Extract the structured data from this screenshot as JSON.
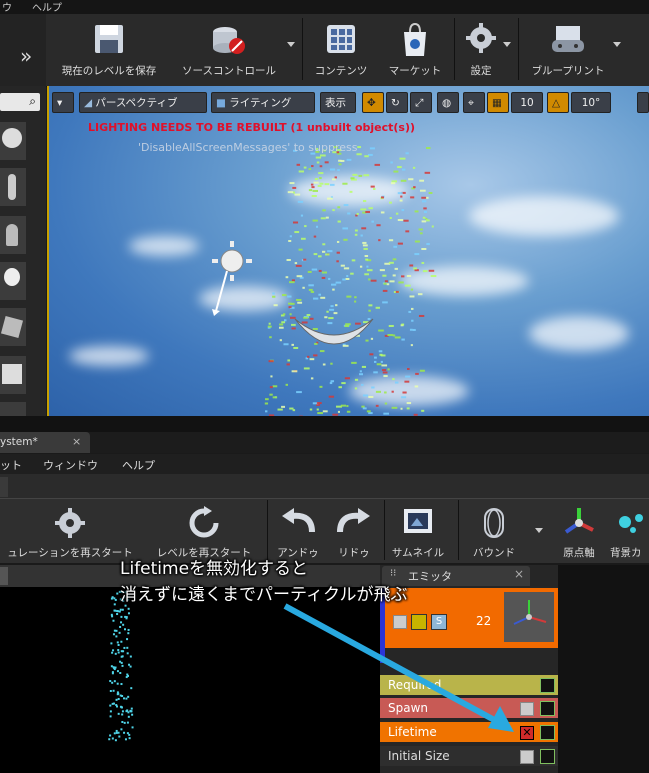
{
  "top_menu": {
    "item1": "ウ",
    "item2": "ヘルプ"
  },
  "main_toolbar": {
    "save": "現在のレベルを保存",
    "source_control": "ソースコントロール",
    "content": "コンテンツ",
    "marketplace": "マーケット",
    "settings": "設定",
    "blueprints": "ブループリント"
  },
  "viewport_toolbar": {
    "perspective": "パースペクティブ",
    "lighting": "ライティング",
    "show": "表示",
    "grid_snap_value": "10",
    "rotate_snap_value": "10°"
  },
  "viewport": {
    "warning": "LIGHTING NEEDS TO BE REBUILT (1 unbuilt object(s))",
    "suppress_hint": "'DisableAllScreenMessages' to suppress"
  },
  "second_window": {
    "tab_title": "ystem*",
    "menu": [
      "ット",
      "ウィンドウ",
      "ヘルプ"
    ],
    "toolbar": {
      "restart_sim": "ュレーションを再スタート",
      "restart_level": "レベルを再スタート",
      "undo": "アンドゥ",
      "redo": "リドゥ",
      "thumbnail": "サムネイル",
      "bounds": "バウンド",
      "origin_axis": "原点軸",
      "background": "背景カ"
    }
  },
  "emitter_panel": {
    "tab_label": "エミッタ",
    "count": "22",
    "modules": [
      {
        "name": "Required",
        "color": "#b9b44a"
      },
      {
        "name": "Spawn",
        "color": "#c85a55"
      },
      {
        "name": "Lifetime",
        "color": "#f07300"
      },
      {
        "name": "Initial Size",
        "color": "#2e2e2e"
      }
    ]
  },
  "annotation": {
    "line1": "Lifetimeを無効化すると",
    "line2": "消えずに遠くまでパーティクルが飛ぶ"
  },
  "colors": {
    "arrow": "#29a9e0",
    "accent_orange": "#f26a00",
    "warning_red": "#e0102a"
  }
}
